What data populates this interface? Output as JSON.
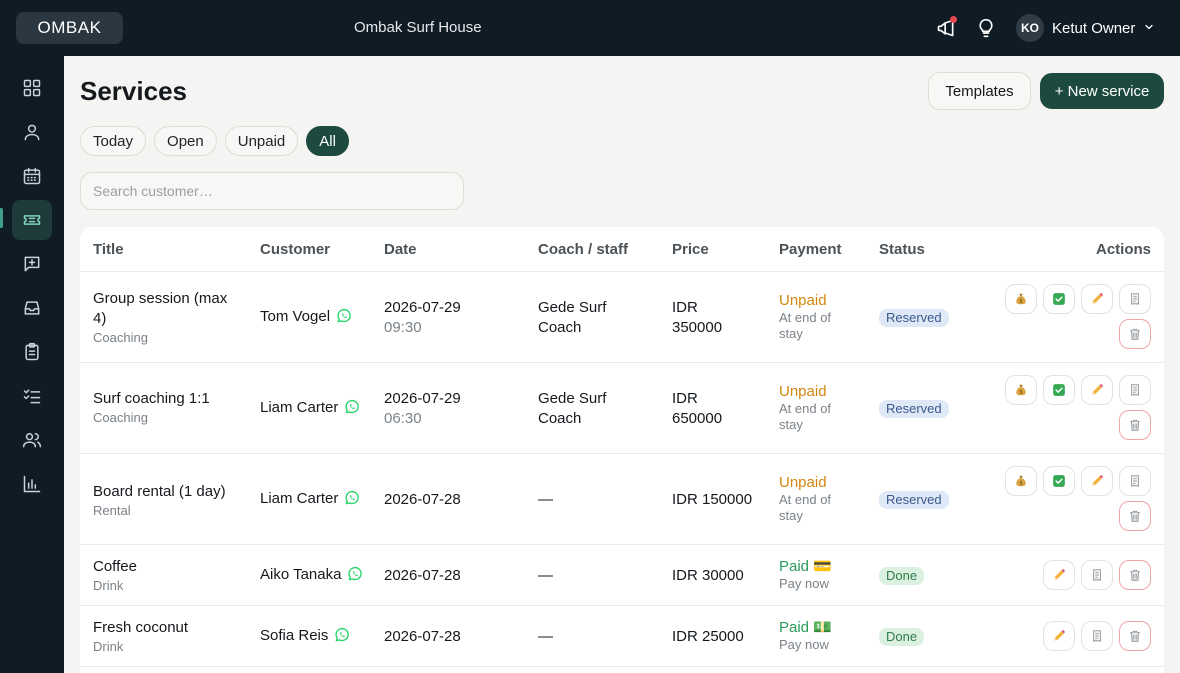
{
  "topbar": {
    "logo": "OMBAK",
    "property_name": "Ombak Surf House",
    "user": {
      "initials": "KO",
      "name": "Ketut Owner"
    }
  },
  "page": {
    "title": "Services",
    "templates_label": "Templates",
    "new_service_label": "+ New service"
  },
  "filters": [
    {
      "label": "Today",
      "active": false
    },
    {
      "label": "Open",
      "active": false
    },
    {
      "label": "Unpaid",
      "active": false
    },
    {
      "label": "All",
      "active": true
    }
  ],
  "search": {
    "placeholder": "Search customer…",
    "value": ""
  },
  "table": {
    "columns": {
      "title": "Title",
      "customer": "Customer",
      "date": "Date",
      "coach": "Coach / staff",
      "price": "Price",
      "payment": "Payment",
      "status": "Status",
      "actions": "Actions"
    },
    "rows": [
      {
        "title": "Group session (max 4)",
        "category": "Coaching",
        "customer": "Tom Vogel",
        "date": "2026-07-29",
        "time": "09:30",
        "coach": "Gede Surf Coach",
        "price": "IDR 350000",
        "payment": "Unpaid",
        "payment_note": "At end of stay",
        "status": "Reserved"
      },
      {
        "title": "Surf coaching 1:1",
        "category": "Coaching",
        "customer": "Liam Carter",
        "date": "2026-07-29",
        "time": "06:30",
        "coach": "Gede Surf Coach",
        "price": "IDR 650000",
        "payment": "Unpaid",
        "payment_note": "At end of stay",
        "status": "Reserved"
      },
      {
        "title": "Board rental (1 day)",
        "category": "Rental",
        "customer": "Liam Carter",
        "date": "2026-07-28",
        "time": "",
        "coach": "—",
        "price": "IDR 150000",
        "payment": "Unpaid",
        "payment_note": "At end of stay",
        "status": "Reserved"
      },
      {
        "title": "Coffee",
        "category": "Drink",
        "customer": "Aiko Tanaka",
        "date": "2026-07-28",
        "time": "",
        "coach": "—",
        "price": "IDR 30000",
        "payment": "Paid 💳",
        "payment_note": "Pay now",
        "status": "Done"
      },
      {
        "title": "Fresh coconut",
        "category": "Drink",
        "customer": "Sofia Reis",
        "date": "2026-07-28",
        "time": "",
        "coach": "—",
        "price": "IDR 25000",
        "payment": "Paid 💵",
        "payment_note": "Pay now",
        "status": "Done"
      }
    ]
  },
  "colors": {
    "topbar_bg": "#0f1c26",
    "primary": "#1d4a3e",
    "unpaid": "#d4870f",
    "paid": "#2a9d5c"
  },
  "icons": {
    "sidebar": [
      "dashboard-icon",
      "user-icon",
      "calendar-icon",
      "ticket-icon",
      "message-plus-icon",
      "inbox-icon",
      "clipboard-icon",
      "checklist-icon",
      "users-icon",
      "chart-icon"
    ],
    "row_actions_unpaid": [
      "money-bag-icon",
      "check-icon",
      "edit-icon",
      "receipt-icon",
      "trash-icon"
    ],
    "row_actions_paid": [
      "edit-icon",
      "receipt-icon",
      "trash-icon"
    ]
  }
}
